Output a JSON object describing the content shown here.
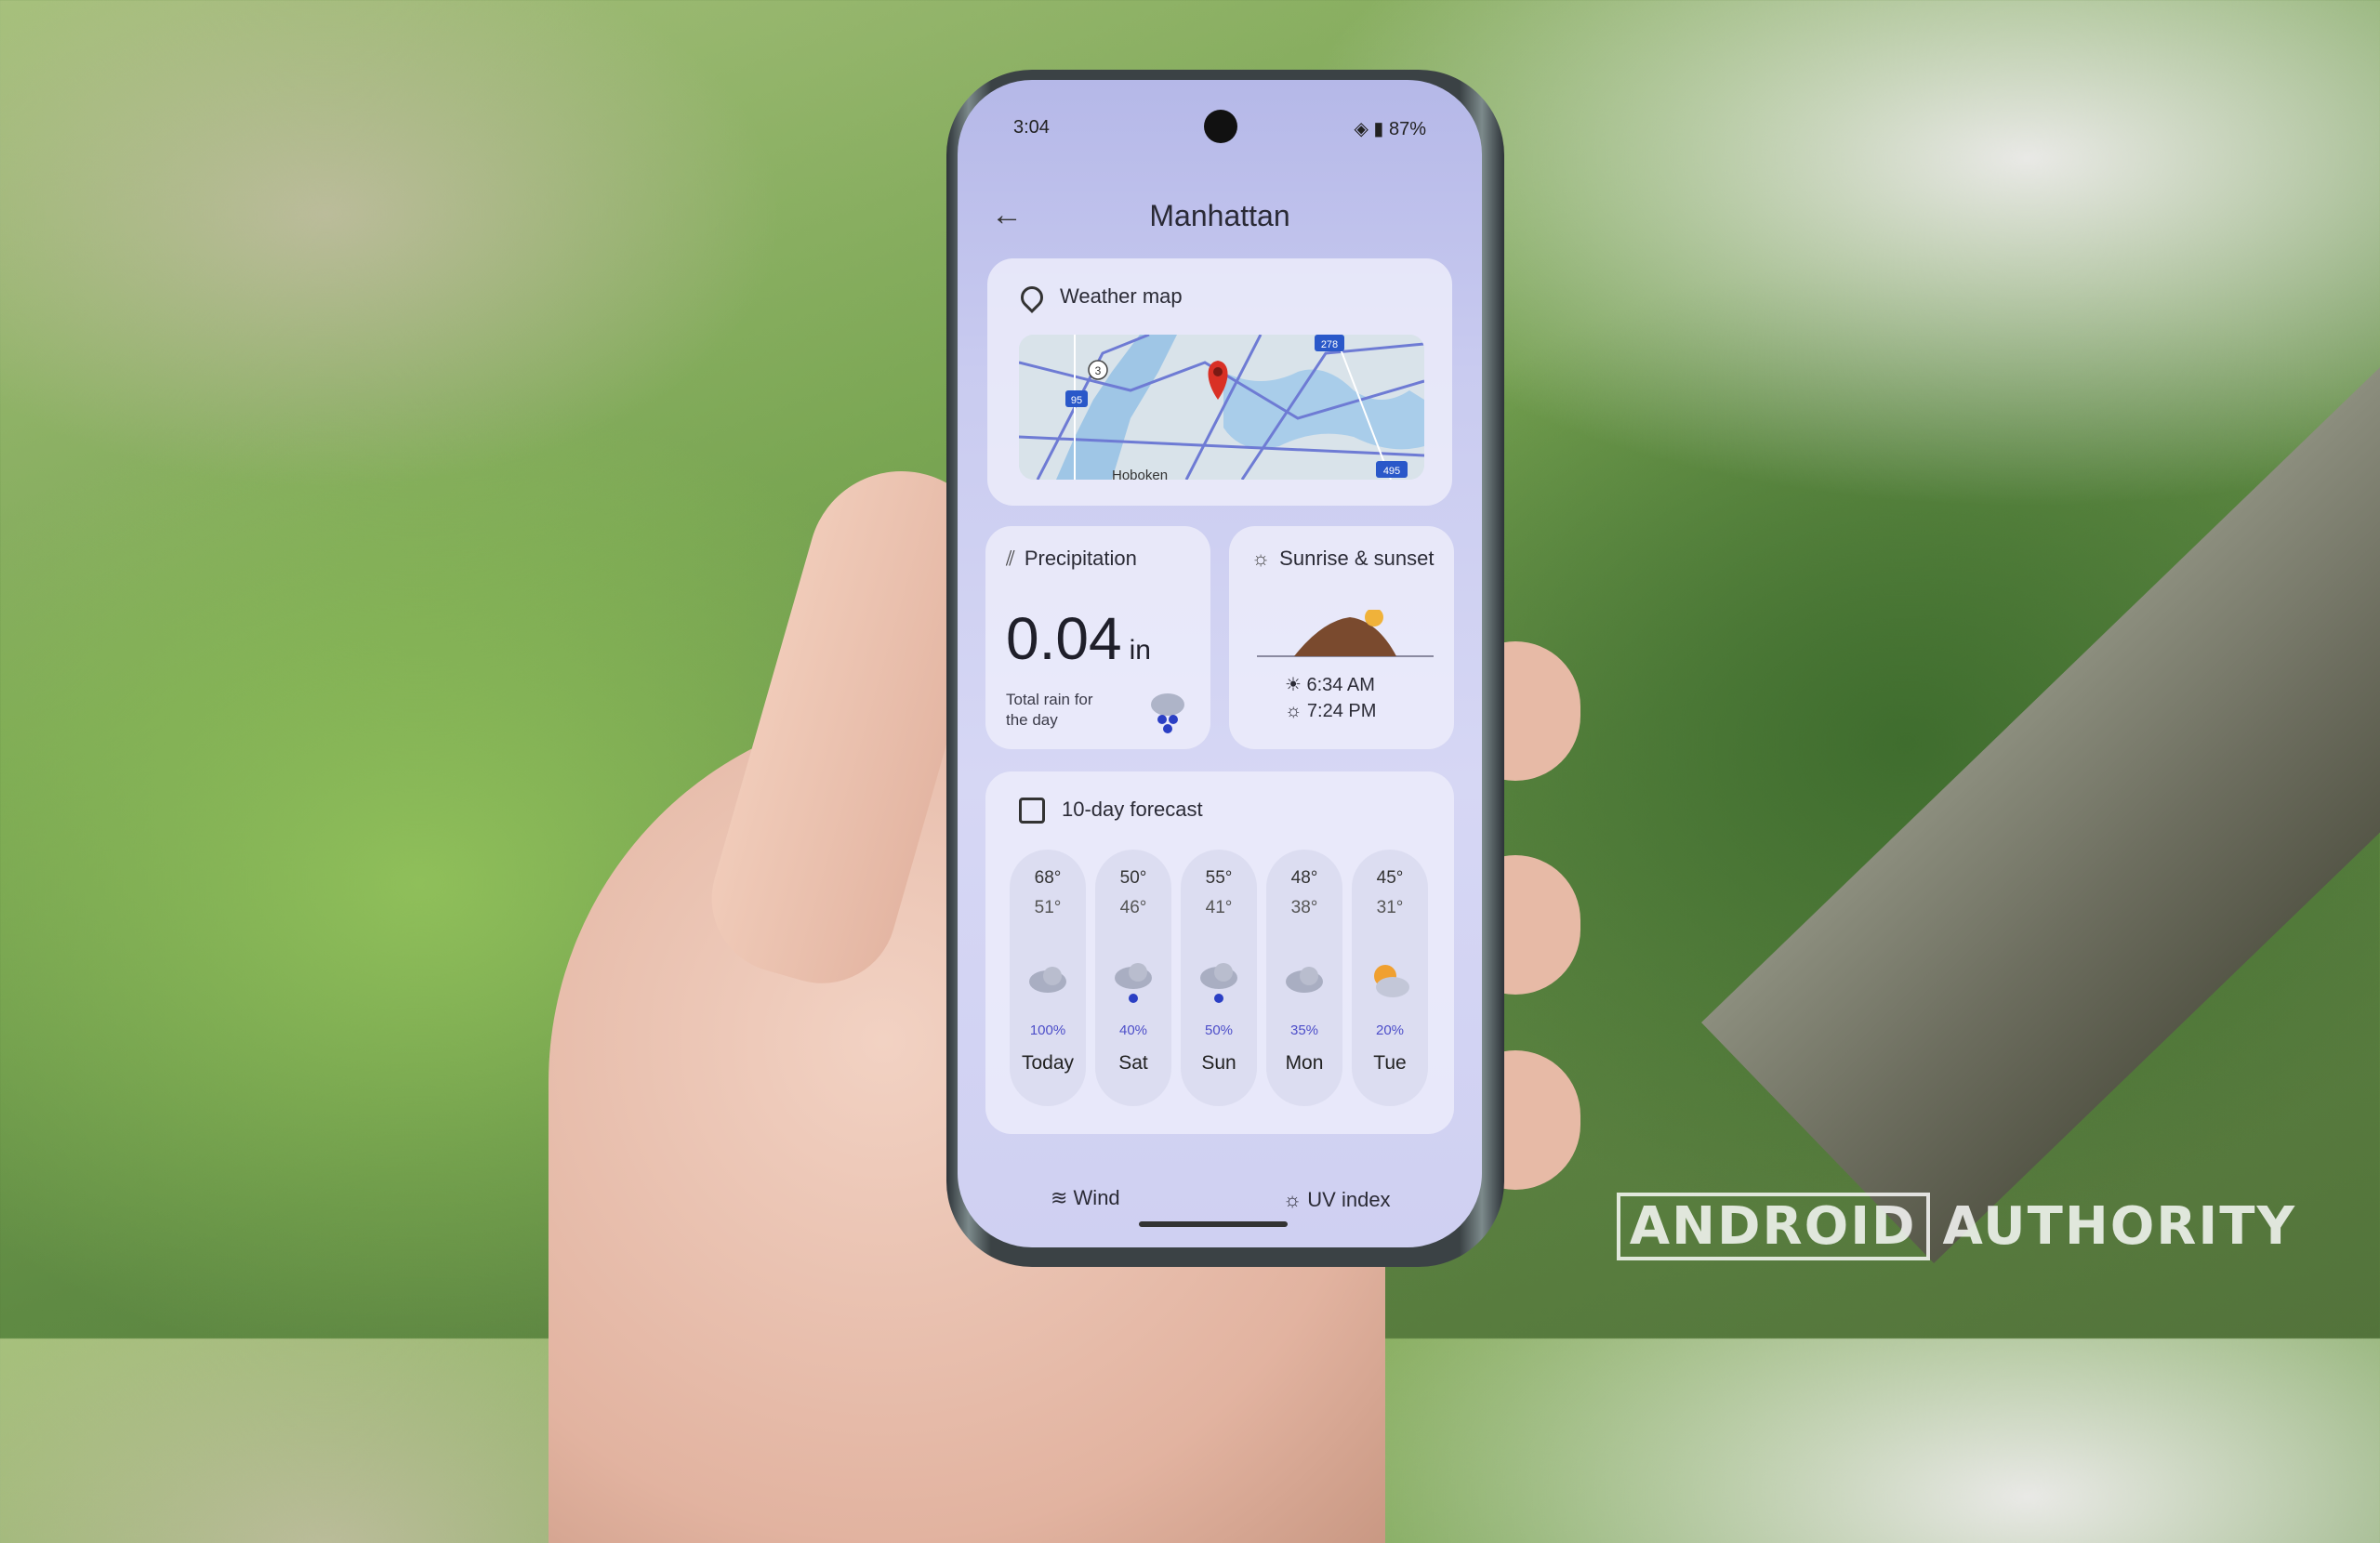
{
  "status_bar": {
    "time": "3:04",
    "battery": "87%"
  },
  "header": {
    "title": "Manhattan",
    "back_icon": "arrow-left-icon"
  },
  "weather_map": {
    "label": "Weather map",
    "map_labels": {
      "route_3": "3",
      "route_95": "95",
      "route_278": "278",
      "route_495": "495",
      "place": "Hoboken"
    }
  },
  "precipitation": {
    "label": "Precipitation",
    "value": "0.04",
    "unit": "in",
    "caption": "Total rain for the day"
  },
  "sunrise_sunset": {
    "label": "Sunrise & sunset",
    "sunrise": "6:34 AM",
    "sunset": "7:24 PM"
  },
  "forecast": {
    "label": "10-day forecast",
    "days": [
      {
        "name": "Today",
        "hi": "68°",
        "lo": "51°",
        "pct": "100%",
        "icon": "cloud-icon"
      },
      {
        "name": "Sat",
        "hi": "50°",
        "lo": "46°",
        "pct": "40%",
        "icon": "rain-icon"
      },
      {
        "name": "Sun",
        "hi": "55°",
        "lo": "41°",
        "pct": "50%",
        "icon": "rain-icon"
      },
      {
        "name": "Mon",
        "hi": "48°",
        "lo": "38°",
        "pct": "35%",
        "icon": "cloud-icon"
      },
      {
        "name": "Tue",
        "hi": "45°",
        "lo": "31°",
        "pct": "20%",
        "icon": "partly-sunny-icon"
      }
    ]
  },
  "bottom_tabs": {
    "wind": "Wind",
    "uv": "UV index"
  },
  "watermark": {
    "part1": "ANDROID",
    "part2": "AUTHORITY"
  },
  "colors": {
    "accent": "#4d4ec9",
    "screen_bg": "#c9cbf0",
    "pin": "#d93025"
  }
}
